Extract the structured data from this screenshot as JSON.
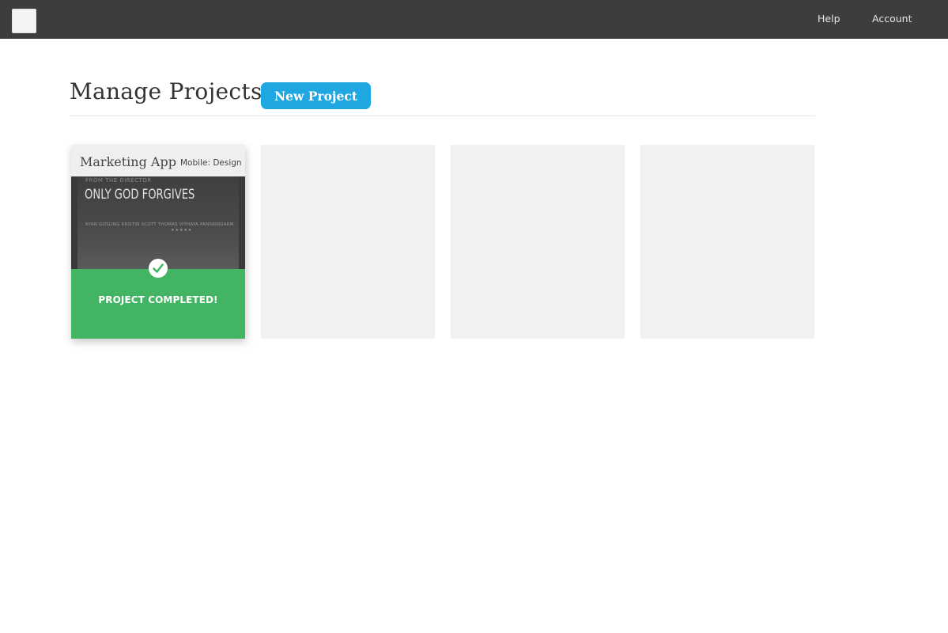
{
  "header": {
    "nav": [
      {
        "label": "Help"
      },
      {
        "label": "Account"
      }
    ]
  },
  "main": {
    "title": "Manage Projects",
    "new_project_label": "New Project",
    "projects": [
      {
        "name": "Marketing App",
        "type": "Mobile: Design",
        "thumbnail": {
          "top_text": "FROM THE DIRECTOR",
          "title": "ONLY GOD FORGIVES",
          "subtitle": "RYAN GOSLING   KRISTIN SCOTT THOMAS   VITHAYA PANSRINGARM",
          "stars": "★★★★★"
        },
        "status": "PROJECT COMPLETED!",
        "status_color": "#43b463"
      }
    ]
  },
  "colors": {
    "topbar": "#3d3d3d",
    "accent": "#1ea7e1",
    "success": "#43b463",
    "placeholder": "#f1f1f1"
  },
  "icons": {
    "status": "check-icon"
  }
}
